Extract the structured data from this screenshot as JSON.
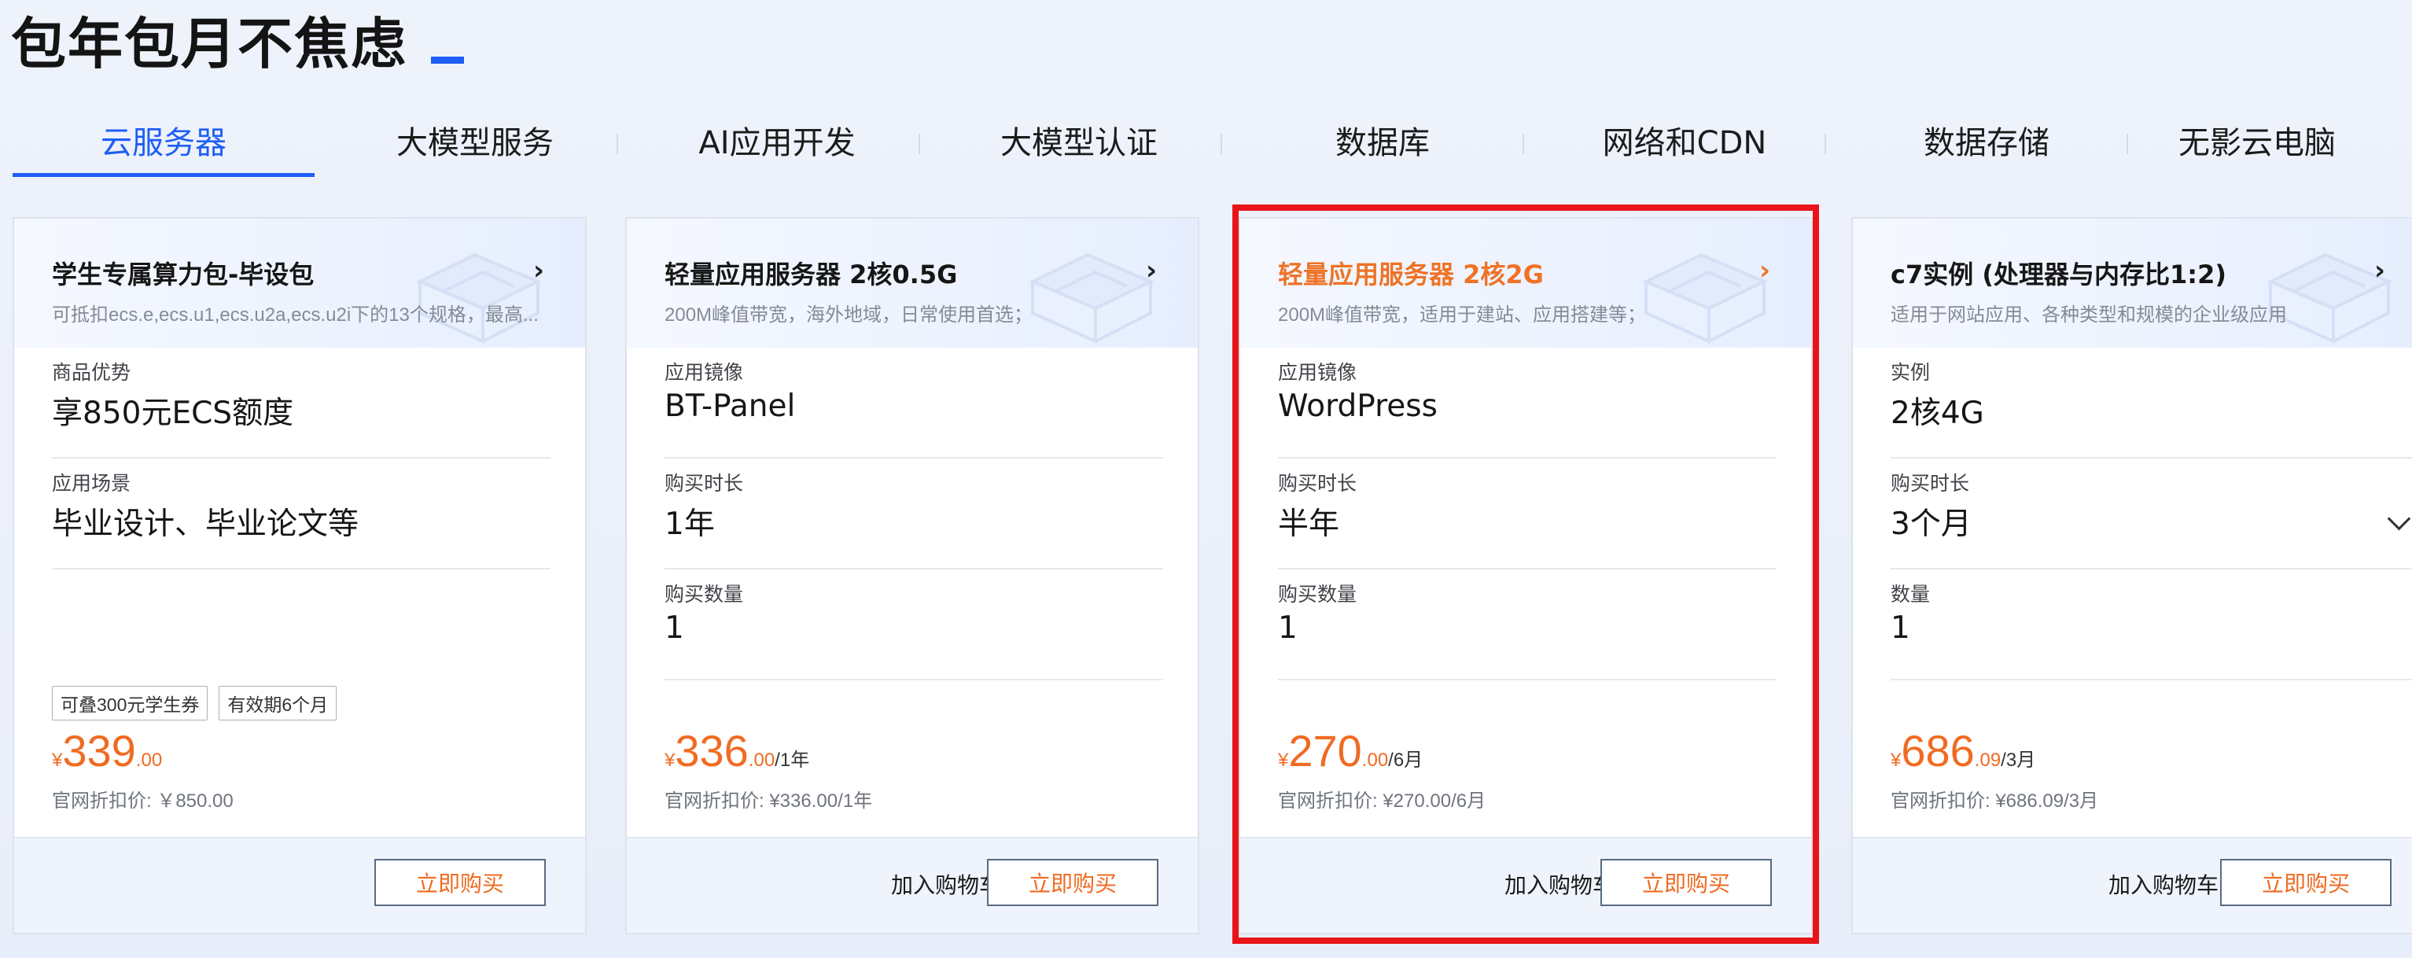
{
  "page_title": "包年包月不焦虑",
  "tabs": [
    "云服务器",
    "大模型服务",
    "AI应用开发",
    "大模型认证",
    "数据库",
    "网络和CDN",
    "数据存储",
    "无影云电脑"
  ],
  "active_tab": "云服务器",
  "cards": [
    {
      "title": "学生专属算力包-毕设包",
      "subtitle": "可抵扣ecs.e,ecs.u1,ecs.u2a,ecs.u2i下的13个规格，最高...",
      "fields": [
        {
          "label": "商品优势",
          "value": "享850元ECS额度"
        },
        {
          "label": "应用场景",
          "value": "毕业设计、毕业论文等"
        }
      ],
      "tags": [
        "可叠300元学生券",
        "有效期6个月"
      ],
      "price": {
        "currency": "¥",
        "integer": "339",
        "decimal": ".00",
        "period": ""
      },
      "list_price": "官网折扣价: ￥850.00",
      "buy_label": "立即购买"
    },
    {
      "title": "轻量应用服务器 2核0.5G",
      "subtitle": "200M峰值带宽，海外地域，日常使用首选；",
      "fields": [
        {
          "label": "应用镜像",
          "value": "BT-Panel"
        },
        {
          "label": "购买时长",
          "value": "1年"
        },
        {
          "label": "购买数量",
          "value": "1"
        }
      ],
      "price": {
        "currency": "¥",
        "integer": "336",
        "decimal": ".00",
        "period": "/1年"
      },
      "list_price": "官网折扣价: ¥336.00/1年",
      "cart_label": "加入购物车",
      "buy_label": "立即购买"
    },
    {
      "title": "轻量应用服务器 2核2G",
      "subtitle": "200M峰值带宽，适用于建站、应用搭建等；",
      "fields": [
        {
          "label": "应用镜像",
          "value": "WordPress"
        },
        {
          "label": "购买时长",
          "value": "半年"
        },
        {
          "label": "购买数量",
          "value": "1"
        }
      ],
      "price": {
        "currency": "¥",
        "integer": "270",
        "decimal": ".00",
        "period": "/6月"
      },
      "list_price": "官网折扣价: ¥270.00/6月",
      "cart_label": "加入购物车",
      "buy_label": "立即购买",
      "highlighted": true
    },
    {
      "title": "c7实例 (处理器与内存比1:2)",
      "subtitle": "适用于网站应用、各种类型和规模的企业级应用",
      "fields": [
        {
          "label": "实例",
          "value": "2核4G"
        },
        {
          "label": "购买时长",
          "value": "3个月"
        },
        {
          "label": "数量",
          "value": "1"
        }
      ],
      "price": {
        "currency": "¥",
        "integer": "686",
        "decimal": ".09",
        "period": "/3月"
      },
      "list_price": "官网折扣价: ¥686.09/3月",
      "cart_label": "加入购物车",
      "buy_label": "立即购买"
    }
  ],
  "colors": {
    "accent": "#1e5ef5",
    "price": "#f06b22",
    "highlight": "#e8141a"
  }
}
